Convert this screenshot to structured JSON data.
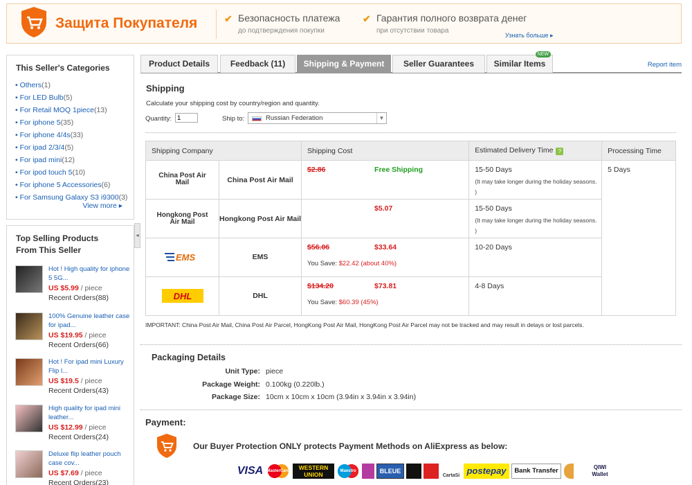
{
  "banner": {
    "title": "Защита Покупателя",
    "features": [
      {
        "title": "Безопасность платежа",
        "subtitle": "до подтверждения покупки"
      },
      {
        "title": "Гарантия полного возврата денег",
        "subtitle": "при отсутствии товара"
      }
    ],
    "learn_more": "Узнать больше ▸"
  },
  "categories": {
    "title": "This Seller's Categories",
    "items": [
      {
        "label": "For LED Bulb",
        "count": "(5)"
      },
      {
        "label": "For Retail MOQ 1piece",
        "count": "(13)"
      },
      {
        "label": "For iphone 5",
        "count": "(35)"
      },
      {
        "label": "For iphone 4/4s",
        "count": "(33)"
      },
      {
        "label": "For ipad 2/3/4",
        "count": "(5)"
      },
      {
        "label": "For ipad mini",
        "count": "(12)"
      },
      {
        "label": "For ipod touch 5",
        "count": "(10)"
      },
      {
        "label": "For iphone 5 Accessories",
        "count": "(6)"
      },
      {
        "label": "For Samsung Galaxy S3 i9300",
        "count": "(3)"
      }
    ],
    "first": {
      "label": "Others",
      "count": "(1)"
    },
    "view_more": "View more ▸"
  },
  "top_selling": {
    "title": "Top Selling Products From This Seller",
    "products": [
      {
        "name": "Hot ! High quality for iphone 5 5G...",
        "price": "US $5.99",
        "unit": " / piece",
        "orders": "Recent Orders(88)"
      },
      {
        "name": "100% Genuine leather case for ipad...",
        "price": "US $19.95",
        "unit": " / piece",
        "orders": "Recent Orders(66)"
      },
      {
        "name": "Hot ! For ipad mini Luxury Flip l...",
        "price": "US $19.5",
        "unit": " / piece",
        "orders": "Recent Orders(43)"
      },
      {
        "name": "High quality for ipad mini leather...",
        "price": "US $12.99",
        "unit": " / piece",
        "orders": "Recent Orders(24)"
      },
      {
        "name": "Deluxe flip leather pouch case cov...",
        "price": "US $7.69",
        "unit": " / piece",
        "orders": "Recent Orders(23)"
      }
    ]
  },
  "tabs": {
    "items": [
      "Product Details",
      "Feedback (11)",
      "Shipping & Payment",
      "Seller Guarantees",
      "Similar Items"
    ],
    "active": "Shipping & Payment",
    "new_badge": "NEW",
    "report": "Report item"
  },
  "shipping": {
    "title": "Shipping",
    "calc_text": "Calculate your shipping cost by country/region and quantity.",
    "quantity_label": "Quantity:",
    "quantity_value": "1",
    "ship_to_label": "Ship to:",
    "ship_to_value": "Russian Federation",
    "headers": [
      "Shipping Company",
      "Shipping Cost",
      "Estimated Delivery Time",
      "Processing Time"
    ],
    "processing_time": "5 Days",
    "rows": [
      {
        "logo": "China Post Air Mail",
        "name": "China Post Air Mail",
        "old_price": "$2.86",
        "price": "Free Shipping",
        "save": "",
        "days": "15-50 Days",
        "note": "(It may take longer during the holiday seasons. )"
      },
      {
        "logo": "Hongkong Post Air Mail",
        "name": "Hongkong Post Air Mail",
        "old_price": "",
        "price": "$5.07",
        "save": "",
        "days": "15-50 Days",
        "note": "(It may take longer during the holiday seasons. )"
      },
      {
        "logo": "EMS",
        "name": "EMS",
        "old_price": "$56.06",
        "price": "$33.64",
        "save_label": "You Save: ",
        "save": "$22.42 (about 40%)",
        "days": "10-20 Days",
        "note": ""
      },
      {
        "logo": "DHL",
        "name": "DHL",
        "old_price": "$134.20",
        "price": "$73.81",
        "save_label": "You Save: ",
        "save": "$60.39 (45%)",
        "days": "4-8 Days",
        "note": ""
      }
    ],
    "important": "IMPORTANT: China Post Air Mail, China Post Air Parcel, HongKong Post Air Mail, HongKong Post Air Parcel may not be tracked and may result in delays or lost parcels."
  },
  "packaging": {
    "title": "Packaging Details",
    "rows": [
      {
        "label": "Unit Type:",
        "value": "piece"
      },
      {
        "label": "Package Weight:",
        "value": "0.100kg (0.220lb.)"
      },
      {
        "label": "Package Size:",
        "value": "10cm x 10cm x 10cm (3.94in x 3.94in x 3.94in)"
      }
    ]
  },
  "payment": {
    "title": "Payment:",
    "note": "Our Buyer Protection ONLY protects Payment Methods on AliExpress as below:",
    "methods": [
      "VISA",
      "MasterCard",
      "WESTERN UNION",
      "Maestro",
      "BLEUE",
      "postepay",
      "Bank Transfer",
      "QIWI Wallet",
      "CartaSi"
    ]
  },
  "colors": {
    "accent": "#f06a0f",
    "link": "#1a5fb4",
    "price": "#d72020",
    "free": "#1f9d1f"
  }
}
